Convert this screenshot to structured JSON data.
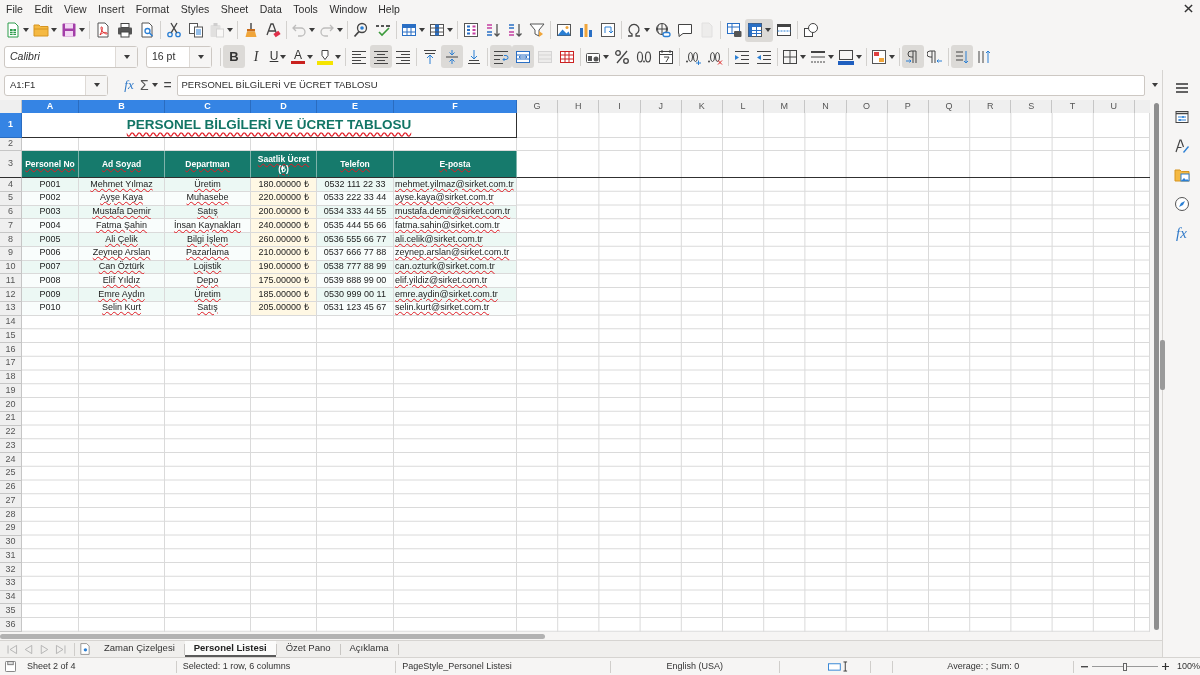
{
  "menu_bar": [
    "File",
    "Edit",
    "View",
    "Insert",
    "Format",
    "Styles",
    "Sheet",
    "Data",
    "Tools",
    "Window",
    "Help"
  ],
  "standard_toolbar": [
    [
      {
        "kind": "new",
        "menu": true,
        "pressed": false,
        "disabled": false
      },
      {
        "kind": "open",
        "menu": true,
        "pressed": false,
        "disabled": false
      },
      {
        "kind": "save",
        "menu": true,
        "pressed": false,
        "disabled": false
      }
    ],
    [
      {
        "kind": "export-pdf",
        "menu": false,
        "pressed": false,
        "disabled": false
      },
      {
        "kind": "print",
        "menu": false,
        "pressed": false,
        "disabled": false
      },
      {
        "kind": "print-preview",
        "menu": false,
        "pressed": false,
        "disabled": false
      }
    ],
    [
      {
        "kind": "cut",
        "menu": false,
        "pressed": false,
        "disabled": false
      },
      {
        "kind": "copy",
        "menu": false,
        "pressed": false,
        "disabled": false
      },
      {
        "kind": "paste",
        "menu": true,
        "pressed": false,
        "disabled": true
      }
    ],
    [
      {
        "kind": "clone-formatting",
        "menu": false,
        "pressed": false,
        "disabled": false
      },
      {
        "kind": "clear-formatting",
        "menu": false,
        "pressed": false,
        "disabled": false
      }
    ],
    [
      {
        "kind": "undo",
        "menu": true,
        "pressed": false,
        "disabled": true
      },
      {
        "kind": "redo",
        "menu": true,
        "pressed": false,
        "disabled": true
      }
    ],
    [
      {
        "kind": "find-replace",
        "menu": false,
        "pressed": false,
        "disabled": false
      },
      {
        "kind": "spelling",
        "menu": false,
        "pressed": false,
        "disabled": false
      }
    ],
    [
      {
        "kind": "rows",
        "menu": true,
        "pressed": false,
        "disabled": false
      },
      {
        "kind": "columns",
        "menu": true,
        "pressed": false,
        "disabled": false
      }
    ],
    [
      {
        "kind": "sort",
        "menu": false,
        "pressed": false,
        "disabled": false
      },
      {
        "kind": "sort-ascending",
        "menu": false,
        "pressed": false,
        "disabled": false
      },
      {
        "kind": "sort-descending",
        "menu": false,
        "pressed": false,
        "disabled": false
      },
      {
        "kind": "autofilter",
        "menu": false,
        "pressed": false,
        "disabled": false
      }
    ],
    [
      {
        "kind": "image",
        "menu": false,
        "pressed": false,
        "disabled": false
      },
      {
        "kind": "chart",
        "menu": false,
        "pressed": false,
        "disabled": false
      },
      {
        "kind": "pivot-table",
        "menu": false,
        "pressed": false,
        "disabled": false
      }
    ],
    [
      {
        "kind": "special-character",
        "menu": true,
        "pressed": false,
        "disabled": false
      },
      {
        "kind": "hyperlink",
        "menu": false,
        "pressed": false,
        "disabled": false
      },
      {
        "kind": "comment",
        "menu": false,
        "pressed": false,
        "disabled": false
      },
      {
        "kind": "headers-footers",
        "menu": false,
        "pressed": false,
        "disabled": true
      }
    ],
    [
      {
        "kind": "print-area",
        "menu": false,
        "pressed": false,
        "disabled": false
      },
      {
        "kind": "freeze",
        "menu": true,
        "pressed": true,
        "disabled": false
      },
      {
        "kind": "split-window",
        "menu": false,
        "pressed": false,
        "disabled": false
      }
    ],
    [
      {
        "kind": "draw-functions",
        "menu": false,
        "pressed": false,
        "disabled": false
      }
    ]
  ],
  "formatting_toolbar": {
    "font_name": "Calibri",
    "font_size": "16 pt",
    "groups": [
      [
        {
          "kind": "bold",
          "label": "B",
          "menu": false,
          "pressed": true,
          "disabled": false
        },
        {
          "kind": "italic",
          "label": "I",
          "menu": false,
          "pressed": false,
          "disabled": false
        },
        {
          "kind": "underline",
          "label": "U",
          "menu": true,
          "pressed": false,
          "disabled": false
        },
        {
          "kind": "font-color",
          "label": "A",
          "menu": true,
          "pressed": false,
          "disabled": false
        },
        {
          "kind": "highlighting",
          "menu": true,
          "pressed": false,
          "disabled": false
        }
      ],
      [
        {
          "kind": "align-left",
          "menu": false,
          "pressed": false,
          "disabled": false
        },
        {
          "kind": "align-center",
          "menu": false,
          "pressed": true,
          "disabled": false
        },
        {
          "kind": "align-right",
          "menu": false,
          "pressed": false,
          "disabled": false
        }
      ],
      [
        {
          "kind": "align-top",
          "menu": false,
          "pressed": false,
          "disabled": false
        },
        {
          "kind": "center-vertically",
          "menu": false,
          "pressed": true,
          "disabled": false
        },
        {
          "kind": "align-bottom",
          "menu": false,
          "pressed": false,
          "disabled": false
        }
      ],
      [
        {
          "kind": "wrap-text",
          "menu": false,
          "pressed": true,
          "disabled": false
        },
        {
          "kind": "merge-center",
          "menu": false,
          "pressed": true,
          "disabled": false
        },
        {
          "kind": "merge-cells",
          "menu": false,
          "pressed": false,
          "disabled": true
        },
        {
          "kind": "unmerge-cells",
          "menu": false,
          "pressed": false,
          "disabled": false
        }
      ],
      [
        {
          "kind": "currency",
          "menu": true,
          "pressed": false,
          "disabled": false
        },
        {
          "kind": "percent",
          "menu": false,
          "pressed": false,
          "disabled": false
        },
        {
          "kind": "number",
          "menu": false,
          "pressed": false,
          "disabled": false
        },
        {
          "kind": "date",
          "menu": false,
          "pressed": false,
          "disabled": false
        }
      ],
      [
        {
          "kind": "add-decimal",
          "menu": false,
          "pressed": false,
          "disabled": false
        },
        {
          "kind": "delete-decimal",
          "menu": false,
          "pressed": false,
          "disabled": false
        }
      ],
      [
        {
          "kind": "increase-indent",
          "menu": false,
          "pressed": false,
          "disabled": false
        },
        {
          "kind": "decrease-indent",
          "menu": false,
          "pressed": false,
          "disabled": false
        }
      ],
      [
        {
          "kind": "borders",
          "menu": true,
          "pressed": false,
          "disabled": false
        },
        {
          "kind": "border-style",
          "menu": true,
          "pressed": false,
          "disabled": false
        },
        {
          "kind": "border-color",
          "menu": true,
          "pressed": false,
          "disabled": false
        }
      ],
      [
        {
          "kind": "conditional",
          "menu": true,
          "pressed": false,
          "disabled": false
        }
      ],
      [
        {
          "kind": "left-to-right",
          "menu": false,
          "pressed": true,
          "disabled": false
        },
        {
          "kind": "right-to-left",
          "menu": false,
          "pressed": false,
          "disabled": false
        }
      ],
      [
        {
          "kind": "text-direction",
          "menu": false,
          "pressed": true,
          "disabled": false
        },
        {
          "kind": "vertical-text",
          "menu": false,
          "pressed": false,
          "disabled": false
        }
      ]
    ]
  },
  "formula_bar": {
    "name_box": "A1:F1",
    "function_wizard": "fx",
    "sum": "Σ",
    "equals": "=",
    "content": "PERSONEL BİLGİLERİ VE ÜCRET TABLOSU"
  },
  "sheet": {
    "column_headers": [
      {
        "label": "A",
        "selected": true
      },
      {
        "label": "B",
        "selected": true
      },
      {
        "label": "C",
        "selected": true
      },
      {
        "label": "D",
        "selected": true
      },
      {
        "label": "E",
        "selected": true
      },
      {
        "label": "F",
        "selected": true
      },
      {
        "label": "G",
        "selected": false
      },
      {
        "label": "H",
        "selected": false
      },
      {
        "label": "I",
        "selected": false
      },
      {
        "label": "J",
        "selected": false
      },
      {
        "label": "K",
        "selected": false
      },
      {
        "label": "L",
        "selected": false
      },
      {
        "label": "M",
        "selected": false
      },
      {
        "label": "N",
        "selected": false
      },
      {
        "label": "O",
        "selected": false
      },
      {
        "label": "P",
        "selected": false
      },
      {
        "label": "Q",
        "selected": false
      },
      {
        "label": "R",
        "selected": false
      },
      {
        "label": "S",
        "selected": false
      },
      {
        "label": "T",
        "selected": false
      },
      {
        "label": "U",
        "selected": false
      }
    ],
    "row_headers": [
      {
        "label": "1",
        "selected": true
      },
      {
        "label": "2",
        "selected": false
      },
      {
        "label": "3",
        "selected": false
      },
      {
        "label": "4",
        "selected": false
      },
      {
        "label": "5",
        "selected": false
      },
      {
        "label": "6",
        "selected": false
      },
      {
        "label": "7",
        "selected": false
      },
      {
        "label": "8",
        "selected": false
      },
      {
        "label": "9",
        "selected": false
      },
      {
        "label": "10",
        "selected": false
      },
      {
        "label": "11",
        "selected": false
      },
      {
        "label": "12",
        "selected": false
      },
      {
        "label": "13",
        "selected": false
      },
      {
        "label": "14",
        "selected": false
      },
      {
        "label": "15",
        "selected": false
      },
      {
        "label": "16",
        "selected": false
      },
      {
        "label": "17",
        "selected": false
      },
      {
        "label": "18",
        "selected": false
      },
      {
        "label": "19",
        "selected": false
      },
      {
        "label": "20",
        "selected": false
      },
      {
        "label": "21",
        "selected": false
      },
      {
        "label": "22",
        "selected": false
      },
      {
        "label": "23",
        "selected": false
      },
      {
        "label": "24",
        "selected": false
      },
      {
        "label": "25",
        "selected": false
      },
      {
        "label": "26",
        "selected": false
      },
      {
        "label": "27",
        "selected": false
      },
      {
        "label": "28",
        "selected": false
      },
      {
        "label": "29",
        "selected": false
      },
      {
        "label": "30",
        "selected": false
      },
      {
        "label": "31",
        "selected": false
      },
      {
        "label": "32",
        "selected": false
      },
      {
        "label": "33",
        "selected": false
      },
      {
        "label": "34",
        "selected": false
      },
      {
        "label": "35",
        "selected": false
      },
      {
        "label": "36",
        "selected": false
      }
    ],
    "title": {
      "text": "PERSONEL BİLGİLERİ VE ÜCRET TABLOSU",
      "misspelled": true
    },
    "columns": [
      {
        "heading": "Personel No",
        "heading_misspelled": true,
        "kind": "code",
        "misspelled": false
      },
      {
        "heading": "Ad Soyad",
        "heading_misspelled": true,
        "kind": "text",
        "misspelled": true
      },
      {
        "heading": "Departman",
        "heading_misspelled": true,
        "kind": "text",
        "misspelled": true
      },
      {
        "heading": "Saatlik Ücret (₺)",
        "heading_misspelled": true,
        "kind": "currency",
        "misspelled": false
      },
      {
        "heading": "Telefon",
        "heading_misspelled": true,
        "kind": "phone",
        "misspelled": false
      },
      {
        "heading": "E-posta",
        "heading_misspelled": true,
        "kind": "email",
        "misspelled": true
      }
    ],
    "rows": [
      [
        "P001",
        "Mehmet Yılmaz",
        "Üretim",
        "180.00000 ₺",
        "0532 111 22 33",
        "mehmet.yilmaz@sirket.com.tr"
      ],
      [
        "P002",
        "Ayşe Kaya",
        "Muhasebe",
        "220.00000 ₺",
        "0533 222 33 44",
        "ayse.kaya@sirket.com.tr"
      ],
      [
        "P003",
        "Mustafa Demir",
        "Satış",
        "200.00000 ₺",
        "0534 333 44 55",
        "mustafa.demir@sirket.com.tr"
      ],
      [
        "P004",
        "Fatma Şahin",
        "İnsan Kaynakları",
        "240.00000 ₺",
        "0535 444 55 66",
        "fatma.sahin@sirket.com.tr"
      ],
      [
        "P005",
        "Ali Çelik",
        "Bilgi İşlem",
        "260.00000 ₺",
        "0536 555 66 77",
        "ali.celik@sirket.com.tr"
      ],
      [
        "P006",
        "Zeynep Arslan",
        "Pazarlama",
        "210.00000 ₺",
        "0537 666 77 88",
        "zeynep.arslan@sirket.com.tr"
      ],
      [
        "P007",
        "Can Öztürk",
        "Lojistik",
        "190.00000 ₺",
        "0538 777 88 99",
        "can.ozturk@sirket.com.tr"
      ],
      [
        "P008",
        "Elif Yıldız",
        "Depo",
        "175.00000 ₺",
        "0539 888 99 00",
        "elif.yildiz@sirket.com.tr"
      ],
      [
        "P009",
        "Emre Aydın",
        "Üretim",
        "185.00000 ₺",
        "0530 999 00 11",
        "emre.aydin@sirket.com.tr"
      ],
      [
        "P010",
        "Selin Kurt",
        "Satış",
        "205.00000 ₺",
        "0531 123 45 67",
        "selin.kurt@sirket.com.tr"
      ]
    ]
  },
  "sheet_tabs": [
    {
      "label": "Zaman Çizelgesi",
      "selected": false
    },
    {
      "label": "Personel Listesi",
      "selected": true
    },
    {
      "label": "Özet Pano",
      "selected": false
    },
    {
      "label": "Açıklama",
      "selected": false
    }
  ],
  "sidebar": {
    "functions": "fx"
  },
  "status_bar": {
    "sheet": "Sheet 2 of 4",
    "selection": "Selected: 1 row, 6 columns",
    "page_style": "PageStyle_Personel Listesi",
    "language": "English (USA)",
    "statistics": "Average: ; Sum: 0",
    "zoom_slider": {
      "level": 0.5
    },
    "zoom": "100%"
  }
}
